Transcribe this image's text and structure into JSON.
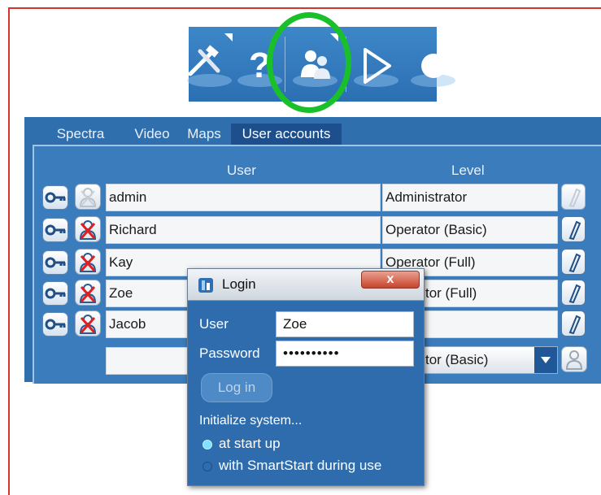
{
  "tabs": [
    "Spectra",
    "Video",
    "Maps",
    "User accounts"
  ],
  "table": {
    "headers": {
      "user": "User",
      "level": "Level"
    },
    "rows": [
      {
        "user": "admin",
        "level": "Administrator"
      },
      {
        "user": "Richard",
        "level": "Operator (Basic)"
      },
      {
        "user": "Kay",
        "level": "Operator (Full)"
      },
      {
        "user": "Zoe",
        "level": "tor (Full)"
      },
      {
        "user": "Jacob",
        "level": ""
      }
    ],
    "new_row": {
      "user": "",
      "level_visible": "tor (Basic)"
    }
  },
  "login_dialog": {
    "title": "Login",
    "close_label": "x",
    "user_label": "User",
    "user_value": "Zoe",
    "password_label": "Password",
    "password_value": "••••••••••",
    "login_button": "Log in",
    "init_label": "Initialize system...",
    "option_startup": "at start up",
    "option_smartstart": "with SmartStart during use"
  },
  "toolbar": {
    "icons": [
      "tools-icon",
      "help-icon",
      "users-icon",
      "play-icon",
      "sphere-icon"
    ],
    "highlight_color": "#19c02a"
  },
  "colors": {
    "panel": "#2f6fae",
    "frame_border": "#d93232"
  }
}
